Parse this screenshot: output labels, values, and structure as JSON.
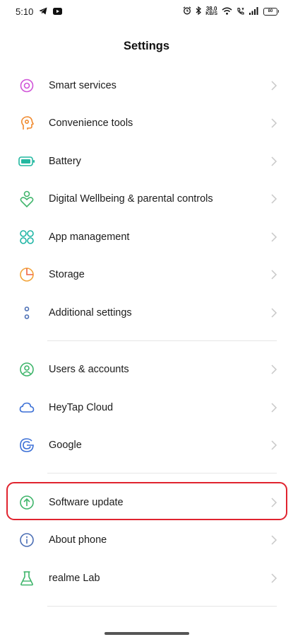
{
  "status_bar": {
    "time": "5:10",
    "net_speed_value": "38.0",
    "net_speed_unit": "KB/S",
    "battery": "80"
  },
  "header": {
    "title": "Settings"
  },
  "groups": [
    {
      "items": [
        {
          "label": "Smart services",
          "icon": "smart-services-icon",
          "color": "#d054d8"
        },
        {
          "label": "Convenience tools",
          "icon": "convenience-tools-icon",
          "color": "#f08a2e"
        },
        {
          "label": "Battery",
          "icon": "battery-icon",
          "color": "#23b8a0"
        },
        {
          "label": "Digital Wellbeing & parental controls",
          "icon": "digital-wellbeing-icon",
          "color": "#3fb56b"
        },
        {
          "label": "App management",
          "icon": "app-management-icon",
          "color": "#1fb5a5"
        },
        {
          "label": "Storage",
          "icon": "storage-icon",
          "color": "#f2a43a"
        },
        {
          "label": "Additional settings",
          "icon": "additional-settings-icon",
          "color": "#4c6fb5"
        }
      ]
    },
    {
      "items": [
        {
          "label": "Users & accounts",
          "icon": "users-accounts-icon",
          "color": "#3fb56b"
        },
        {
          "label": "HeyTap Cloud",
          "icon": "cloud-icon",
          "color": "#3b6fd6"
        },
        {
          "label": "Google",
          "icon": "google-icon",
          "color": "#3b6fd6"
        }
      ]
    },
    {
      "items": [
        {
          "label": "Software update",
          "icon": "software-update-icon",
          "color": "#3fb56b",
          "highlighted": true
        },
        {
          "label": "About phone",
          "icon": "about-phone-icon",
          "color": "#4c6fb5"
        },
        {
          "label": "realme Lab",
          "icon": "lab-flask-icon",
          "color": "#3fb56b"
        }
      ]
    }
  ],
  "highlight_color": "#e0242f"
}
